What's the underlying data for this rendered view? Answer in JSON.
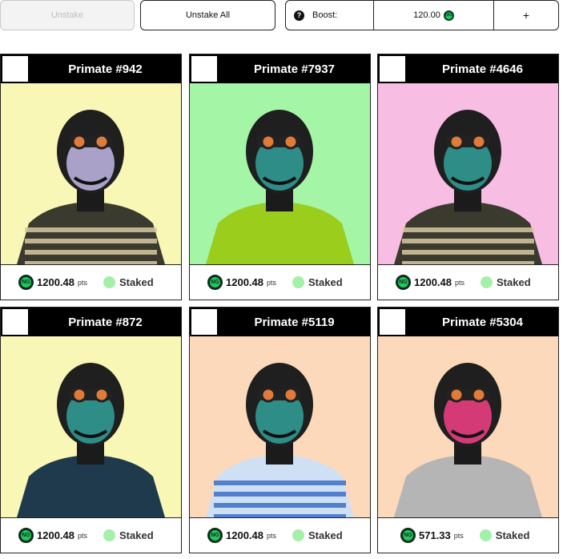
{
  "toolbar": {
    "unstake_label": "Unstake",
    "unstake_all_label": "Unstake All",
    "boost_label": "Boost:",
    "boost_value": "120.00",
    "plus_label": "+",
    "help_glyph": "?"
  },
  "token_badge_text": "NG",
  "cards": [
    {
      "title": "Primate #942",
      "points": "1200.48",
      "unit": "pts",
      "status": "Staked",
      "bg": "#f9f7b6"
    },
    {
      "title": "Primate #7937",
      "points": "1200.48",
      "unit": "pts",
      "status": "Staked",
      "bg": "#a5f5a6"
    },
    {
      "title": "Primate #4646",
      "points": "1200.48",
      "unit": "pts",
      "status": "Staked",
      "bg": "#f8bde2"
    },
    {
      "title": "Primate #872",
      "points": "1200.48",
      "unit": "pts",
      "status": "Staked",
      "bg": "#f9f7b6"
    },
    {
      "title": "Primate #5119",
      "points": "1200.48",
      "unit": "pts",
      "status": "Staked",
      "bg": "#fcd9bb"
    },
    {
      "title": "Primate #5304",
      "points": "571.33",
      "unit": "pts",
      "status": "Staked",
      "bg": "#fcd9bb"
    }
  ],
  "colors": {
    "accent_green": "#22c55e",
    "staked_dot": "#a3f0a8",
    "header_black": "#000000"
  }
}
